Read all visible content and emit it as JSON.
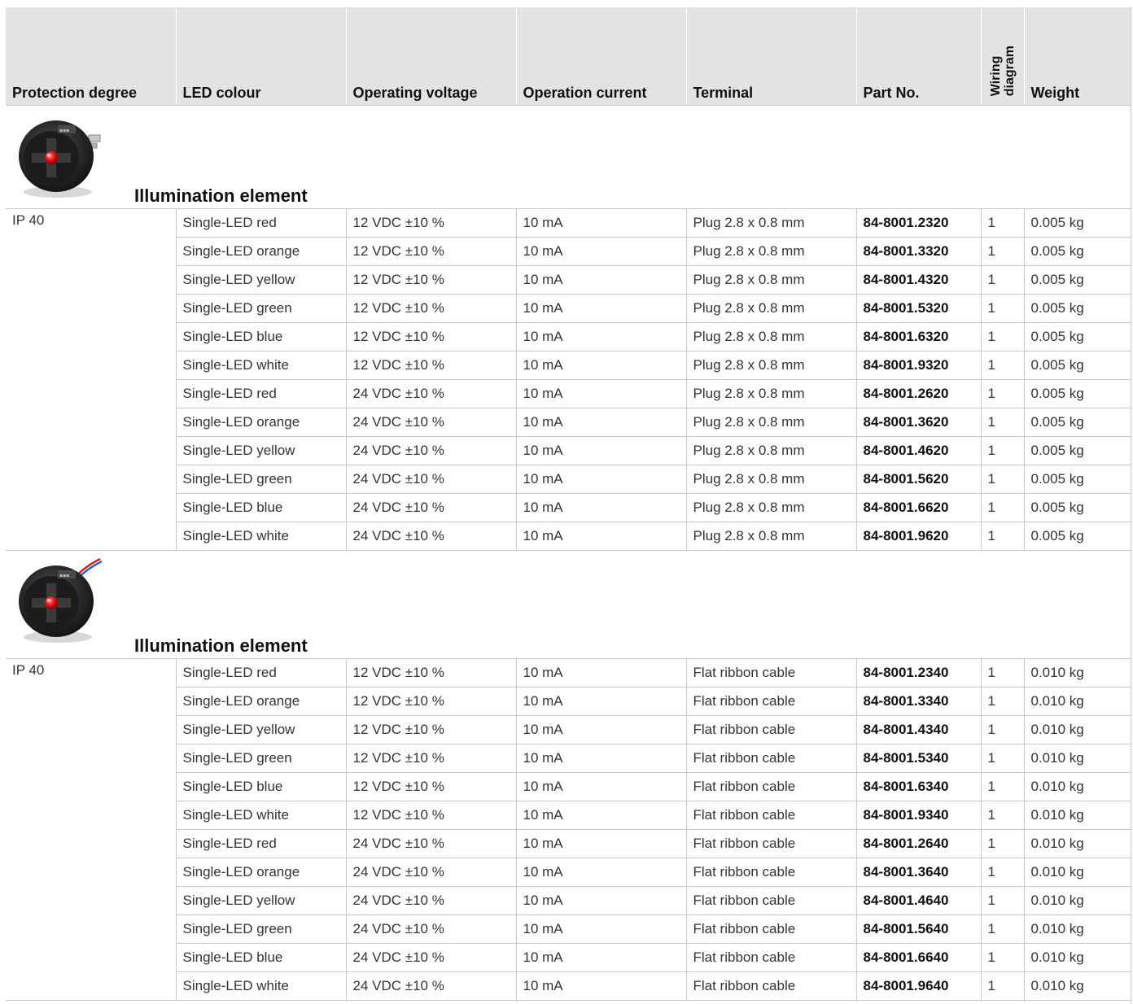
{
  "headers": [
    "Protection degree",
    "LED colour",
    "Operating voltage",
    "Operation current",
    "Terminal",
    "Part No.",
    "Wiring diagram",
    "Weight"
  ],
  "headers_vertical_index": 6,
  "headers_vertical_lines": [
    "Wiring",
    "diagram"
  ],
  "sections": [
    {
      "title": "Illumination element",
      "image": "illumination-element-plug-photo",
      "protection": "IP 40",
      "rows": [
        [
          "Single-LED red",
          "12 VDC ±10 %",
          "10 mA",
          "Plug 2.8 x 0.8 mm",
          "84-8001.2320",
          "1",
          "0.005 kg"
        ],
        [
          "Single-LED orange",
          "12 VDC ±10 %",
          "10 mA",
          "Plug 2.8 x 0.8 mm",
          "84-8001.3320",
          "1",
          "0.005 kg"
        ],
        [
          "Single-LED yellow",
          "12 VDC ±10 %",
          "10 mA",
          "Plug 2.8 x 0.8 mm",
          "84-8001.4320",
          "1",
          "0.005 kg"
        ],
        [
          "Single-LED green",
          "12 VDC ±10 %",
          "10 mA",
          "Plug 2.8 x 0.8 mm",
          "84-8001.5320",
          "1",
          "0.005 kg"
        ],
        [
          "Single-LED blue",
          "12 VDC ±10 %",
          "10 mA",
          "Plug 2.8 x 0.8 mm",
          "84-8001.6320",
          "1",
          "0.005 kg"
        ],
        [
          "Single-LED white",
          "12 VDC ±10 %",
          "10 mA",
          "Plug 2.8 x 0.8 mm",
          "84-8001.9320",
          "1",
          "0.005 kg"
        ],
        [
          "Single-LED red",
          "24 VDC ±10 %",
          "10 mA",
          "Plug 2.8 x 0.8 mm",
          "84-8001.2620",
          "1",
          "0.005 kg"
        ],
        [
          "Single-LED orange",
          "24 VDC ±10 %",
          "10 mA",
          "Plug 2.8 x 0.8 mm",
          "84-8001.3620",
          "1",
          "0.005 kg"
        ],
        [
          "Single-LED yellow",
          "24 VDC ±10 %",
          "10 mA",
          "Plug 2.8 x 0.8 mm",
          "84-8001.4620",
          "1",
          "0.005 kg"
        ],
        [
          "Single-LED green",
          "24 VDC ±10 %",
          "10 mA",
          "Plug 2.8 x 0.8 mm",
          "84-8001.5620",
          "1",
          "0.005 kg"
        ],
        [
          "Single-LED blue",
          "24 VDC ±10 %",
          "10 mA",
          "Plug 2.8 x 0.8 mm",
          "84-8001.6620",
          "1",
          "0.005 kg"
        ],
        [
          "Single-LED white",
          "24 VDC ±10 %",
          "10 mA",
          "Plug 2.8 x 0.8 mm",
          "84-8001.9620",
          "1",
          "0.005 kg"
        ]
      ]
    },
    {
      "title": "Illumination element",
      "image": "illumination-element-cable-photo",
      "protection": "IP 40",
      "rows": [
        [
          "Single-LED red",
          "12 VDC ±10 %",
          "10 mA",
          "Flat ribbon cable",
          "84-8001.2340",
          "1",
          "0.010 kg"
        ],
        [
          "Single-LED orange",
          "12 VDC ±10 %",
          "10 mA",
          "Flat ribbon cable",
          "84-8001.3340",
          "1",
          "0.010 kg"
        ],
        [
          "Single-LED yellow",
          "12 VDC ±10 %",
          "10 mA",
          "Flat ribbon cable",
          "84-8001.4340",
          "1",
          "0.010 kg"
        ],
        [
          "Single-LED green",
          "12 VDC ±10 %",
          "10 mA",
          "Flat ribbon cable",
          "84-8001.5340",
          "1",
          "0.010 kg"
        ],
        [
          "Single-LED blue",
          "12 VDC ±10 %",
          "10 mA",
          "Flat ribbon cable",
          "84-8001.6340",
          "1",
          "0.010 kg"
        ],
        [
          "Single-LED white",
          "12 VDC ±10 %",
          "10 mA",
          "Flat ribbon cable",
          "84-8001.9340",
          "1",
          "0.010 kg"
        ],
        [
          "Single-LED red",
          "24 VDC ±10 %",
          "10 mA",
          "Flat ribbon cable",
          "84-8001.2640",
          "1",
          "0.010 kg"
        ],
        [
          "Single-LED orange",
          "24 VDC ±10 %",
          "10 mA",
          "Flat ribbon cable",
          "84-8001.3640",
          "1",
          "0.010 kg"
        ],
        [
          "Single-LED yellow",
          "24 VDC ±10 %",
          "10 mA",
          "Flat ribbon cable",
          "84-8001.4640",
          "1",
          "0.010 kg"
        ],
        [
          "Single-LED green",
          "24 VDC ±10 %",
          "10 mA",
          "Flat ribbon cable",
          "84-8001.5640",
          "1",
          "0.010 kg"
        ],
        [
          "Single-LED blue",
          "24 VDC ±10 %",
          "10 mA",
          "Flat ribbon cable",
          "84-8001.6640",
          "1",
          "0.010 kg"
        ],
        [
          "Single-LED white",
          "24 VDC ±10 %",
          "10 mA",
          "Flat ribbon cable",
          "84-8001.9640",
          "1",
          "0.010 kg"
        ]
      ]
    }
  ],
  "colors": {
    "header_bg": "#e3e3e3",
    "grid_line": "#c8c8c8",
    "text": "#333333"
  }
}
